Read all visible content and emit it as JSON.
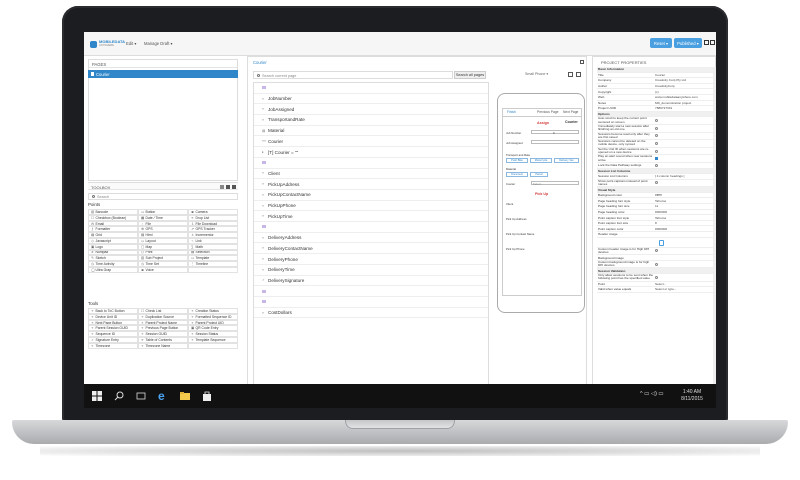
{
  "app": {
    "logo_line1": "MOBILEDATA",
    "logo_line2": "ANYWHERE",
    "menu": [
      "Edit ▾",
      "Manage Draft ▾"
    ],
    "reset_label": "Reset ▾",
    "published_label": "Published ▾"
  },
  "pages_panel": {
    "title": "PAGES",
    "selected_page": "Courier"
  },
  "toolbox": {
    "title": "TOOLBOX",
    "search_placeholder": "Search",
    "points_title": "Points",
    "points": [
      {
        "icon": "▥",
        "label": "Barcode"
      },
      {
        "icon": "▭",
        "label": "Button"
      },
      {
        "icon": "◙",
        "label": "Camera"
      },
      {
        "icon": "☐",
        "label": "Checkbox (Boolean)"
      },
      {
        "icon": "▦",
        "label": "Date / Time"
      },
      {
        "icon": "≡",
        "label": "Drop List"
      },
      {
        "icon": "✉",
        "label": "Email"
      },
      {
        "icon": "▫",
        "label": "File"
      },
      {
        "icon": "⇩",
        "label": "File Download"
      },
      {
        "icon": "ƒ",
        "label": "Formatter"
      },
      {
        "icon": "⊕",
        "label": "GPS"
      },
      {
        "icon": "⇗",
        "label": "GPS Tracker"
      },
      {
        "icon": "▤",
        "label": "Grid"
      },
      {
        "icon": "▤",
        "label": "Html"
      },
      {
        "icon": "±",
        "label": "Incrementor"
      },
      {
        "icon": "◇",
        "label": "Javascript"
      },
      {
        "icon": "▭",
        "label": "Layout"
      },
      {
        "icon": "⌁",
        "label": "Link"
      },
      {
        "icon": "▣",
        "label": "Logo"
      },
      {
        "icon": "▢",
        "label": "Map"
      },
      {
        "icon": "∑",
        "label": "Math"
      },
      {
        "icon": "#",
        "label": "Numpad"
      },
      {
        "icon": "⎙",
        "label": "Print"
      },
      {
        "icon": "▤",
        "label": "Selection"
      },
      {
        "icon": "✎",
        "label": "Sketch"
      },
      {
        "icon": "▥",
        "label": "Sub Project"
      },
      {
        "icon": "▭",
        "label": "Template"
      },
      {
        "icon": "◷",
        "label": "Time Activity"
      },
      {
        "icon": "◷",
        "label": "Time Set"
      },
      {
        "icon": "⋮",
        "label": "Timeline"
      },
      {
        "icon": "◯",
        "label": "Ultra Grap"
      },
      {
        "icon": "◙",
        "label": "Voice"
      },
      {
        "icon": "",
        "label": ""
      }
    ],
    "tools_title": "Tools",
    "tools": [
      {
        "icon": "«",
        "label": "Back to ToC Button"
      },
      {
        "icon": "☐",
        "label": "Check List"
      },
      {
        "icon": "«",
        "label": "Creation Status"
      },
      {
        "icon": "«",
        "label": "Device Unit ID"
      },
      {
        "icon": "«",
        "label": "Duplication Source"
      },
      {
        "icon": "«",
        "label": "Formatted Sequence ID"
      },
      {
        "icon": "«",
        "label": "Next Page Button"
      },
      {
        "icon": "«",
        "label": "Parent Project Name"
      },
      {
        "icon": "«",
        "label": "Parent Project UID"
      },
      {
        "icon": "«",
        "label": "Parent Session GUID"
      },
      {
        "icon": "«",
        "label": "Previous Page Button"
      },
      {
        "icon": "▣",
        "label": "QR Code Entry"
      },
      {
        "icon": "«",
        "label": "Sequence ID"
      },
      {
        "icon": "«",
        "label": "Session GUID"
      },
      {
        "icon": "«",
        "label": "Session Status"
      },
      {
        "icon": "✓",
        "label": "Signature Entry"
      },
      {
        "icon": "≡",
        "label": "Table of Contents"
      },
      {
        "icon": "«",
        "label": "Template Sequence"
      },
      {
        "icon": "«",
        "label": "Timezone"
      },
      {
        "icon": "«",
        "label": "Timezone Name"
      },
      {
        "icon": "",
        "label": ""
      }
    ]
  },
  "center": {
    "title": "Courier",
    "search_placeholder": "Search current page",
    "search_button": "Search all pages",
    "device_label": "Small Phone ▾",
    "rows": [
      {
        "icon": "sep",
        "label": ""
      },
      {
        "icon": "«",
        "label": "JobNumber"
      },
      {
        "icon": "«",
        "label": "JobAssigned"
      },
      {
        "icon": "«",
        "label": "TransportandRate"
      },
      {
        "icon": "▤",
        "label": "Material"
      },
      {
        "icon": "«»",
        "label": "Courier"
      },
      {
        "icon": "▸",
        "label": "[T] Courier = \"\""
      },
      {
        "icon": "sep",
        "label": ""
      },
      {
        "icon": "«",
        "label": "Client"
      },
      {
        "icon": "«",
        "label": "PickUpAddress"
      },
      {
        "icon": "«",
        "label": "PickUpContactName"
      },
      {
        "icon": "«",
        "label": "PickUpPhone"
      },
      {
        "icon": "«",
        "label": "PickUpTime"
      },
      {
        "icon": "sep",
        "label": ""
      },
      {
        "icon": "«",
        "label": "DeliveryAddress"
      },
      {
        "icon": "«",
        "label": "DeliveryContactName"
      },
      {
        "icon": "«",
        "label": "DeliveryPhone"
      },
      {
        "icon": "«",
        "label": "DeliveryTime"
      },
      {
        "icon": "✓",
        "label": "DeliverySignature"
      },
      {
        "icon": "sep",
        "label": ""
      },
      {
        "icon": "sep",
        "label": ""
      },
      {
        "icon": "«",
        "label": "CostDollars"
      }
    ]
  },
  "phone": {
    "tabs": [
      "Finish",
      "Previous Page",
      "Next Page"
    ],
    "assign": "Assign",
    "courier": "Courier",
    "job_number": "Job Number",
    "job_number_value": "0",
    "job_assigned": "Job Assigned",
    "transport_rate": "Transport and Rate",
    "transport_buttons": [
      "Push Bike",
      "Motorcycle",
      "Delivery Van"
    ],
    "material": "Material",
    "material_buttons": [
      "Document",
      "Parcel"
    ],
    "courier_label": "Courier",
    "courier_select": "Select...",
    "pickup": "Pick Up",
    "client": "Client",
    "pickup_address": "Pick Up Address",
    "pickup_contact": "Pick Up Contact Name",
    "pickup_phone": "Pick Up Phone"
  },
  "properties": {
    "title": "PROJECT PROPERTIES",
    "rows": [
      {
        "type": "sec",
        "k": "Basic Information",
        "v": ""
      },
      {
        "type": "kv",
        "k": "Title",
        "v": "Courier"
      },
      {
        "type": "kv",
        "k": "Company",
        "v": "Creativity Corp Pty Ltd"
      },
      {
        "type": "kv",
        "k": "Author",
        "v": "CreativityCorp"
      },
      {
        "type": "kv",
        "k": "Copyright",
        "v": "(c)"
      },
      {
        "type": "kv",
        "k": "Web",
        "v": "www.mobiledataanywhere.com"
      },
      {
        "type": "kv",
        "k": "Notes",
        "v": "MD_demonstration project"
      },
      {
        "type": "kv",
        "k": "Project UUID",
        "v": "7889727331"
      },
      {
        "type": "sec",
        "k": "Options",
        "v": ""
      },
      {
        "type": "chk",
        "k": "Auto scroll to keep the current point centered on screen",
        "v": "off"
      },
      {
        "type": "chk",
        "k": "Immediately start a new session after finishing an old one",
        "v": "off"
      },
      {
        "type": "chk",
        "k": "Sessions become read only after they are first saved",
        "v": "off"
      },
      {
        "type": "chk",
        "k": "Sessions cannot be deleted on the mobile device, only synced",
        "v": "off"
      },
      {
        "type": "chk",
        "k": "Set the Unit ID when sessions are re-opened on a new device",
        "v": "off"
      },
      {
        "type": "chk",
        "k": "Play an alert sound when new sessions arrive",
        "v": "on"
      },
      {
        "type": "chk",
        "k": "Lock the Data Pathway settings",
        "v": "off"
      },
      {
        "type": "sec",
        "k": "Session List Columns",
        "v": ""
      },
      {
        "type": "kv",
        "k": "Session List Columns",
        "v": "[ 4 column headings ]"
      },
      {
        "type": "chk",
        "k": "Show point captions instead of point names",
        "v": "off"
      },
      {
        "type": "sec",
        "k": "Visual Style",
        "v": ""
      },
      {
        "type": "kv",
        "k": "Background color",
        "v": "#ffffff"
      },
      {
        "type": "kv",
        "k": "Page heading font style",
        "v": "Tahoma"
      },
      {
        "type": "kv",
        "k": "Page heading font size",
        "v": "11"
      },
      {
        "type": "kv",
        "k": "Page heading color",
        "v": "#000000"
      },
      {
        "type": "kv",
        "k": "Point caption font style",
        "v": "Tahoma"
      },
      {
        "type": "kv",
        "k": "Point caption font size",
        "v": "8"
      },
      {
        "type": "kv",
        "k": "Point caption color",
        "v": "#000000"
      },
      {
        "type": "kv",
        "k": "Header image",
        "v": ""
      },
      {
        "type": "img",
        "k": "",
        "v": ""
      },
      {
        "type": "chk",
        "k": "Custom header image is for High DPI devices",
        "v": "off"
      },
      {
        "type": "kv",
        "k": "Background image",
        "v": ""
      },
      {
        "type": "chk",
        "k": "Custom background image is for high DPI devices",
        "v": "off"
      },
      {
        "type": "sec",
        "k": "Session Validation",
        "v": ""
      },
      {
        "type": "chk",
        "k": "Only allow sessions to be sent when the following point has the specified value",
        "v": "off"
      },
      {
        "type": "kv",
        "k": "Point",
        "v": "Select..."
      },
      {
        "type": "kv",
        "k": "Valid when value equals",
        "v": "Select or type..."
      }
    ]
  },
  "taskbar": {
    "time": "1:40 AM",
    "date": "8/11/2015"
  }
}
